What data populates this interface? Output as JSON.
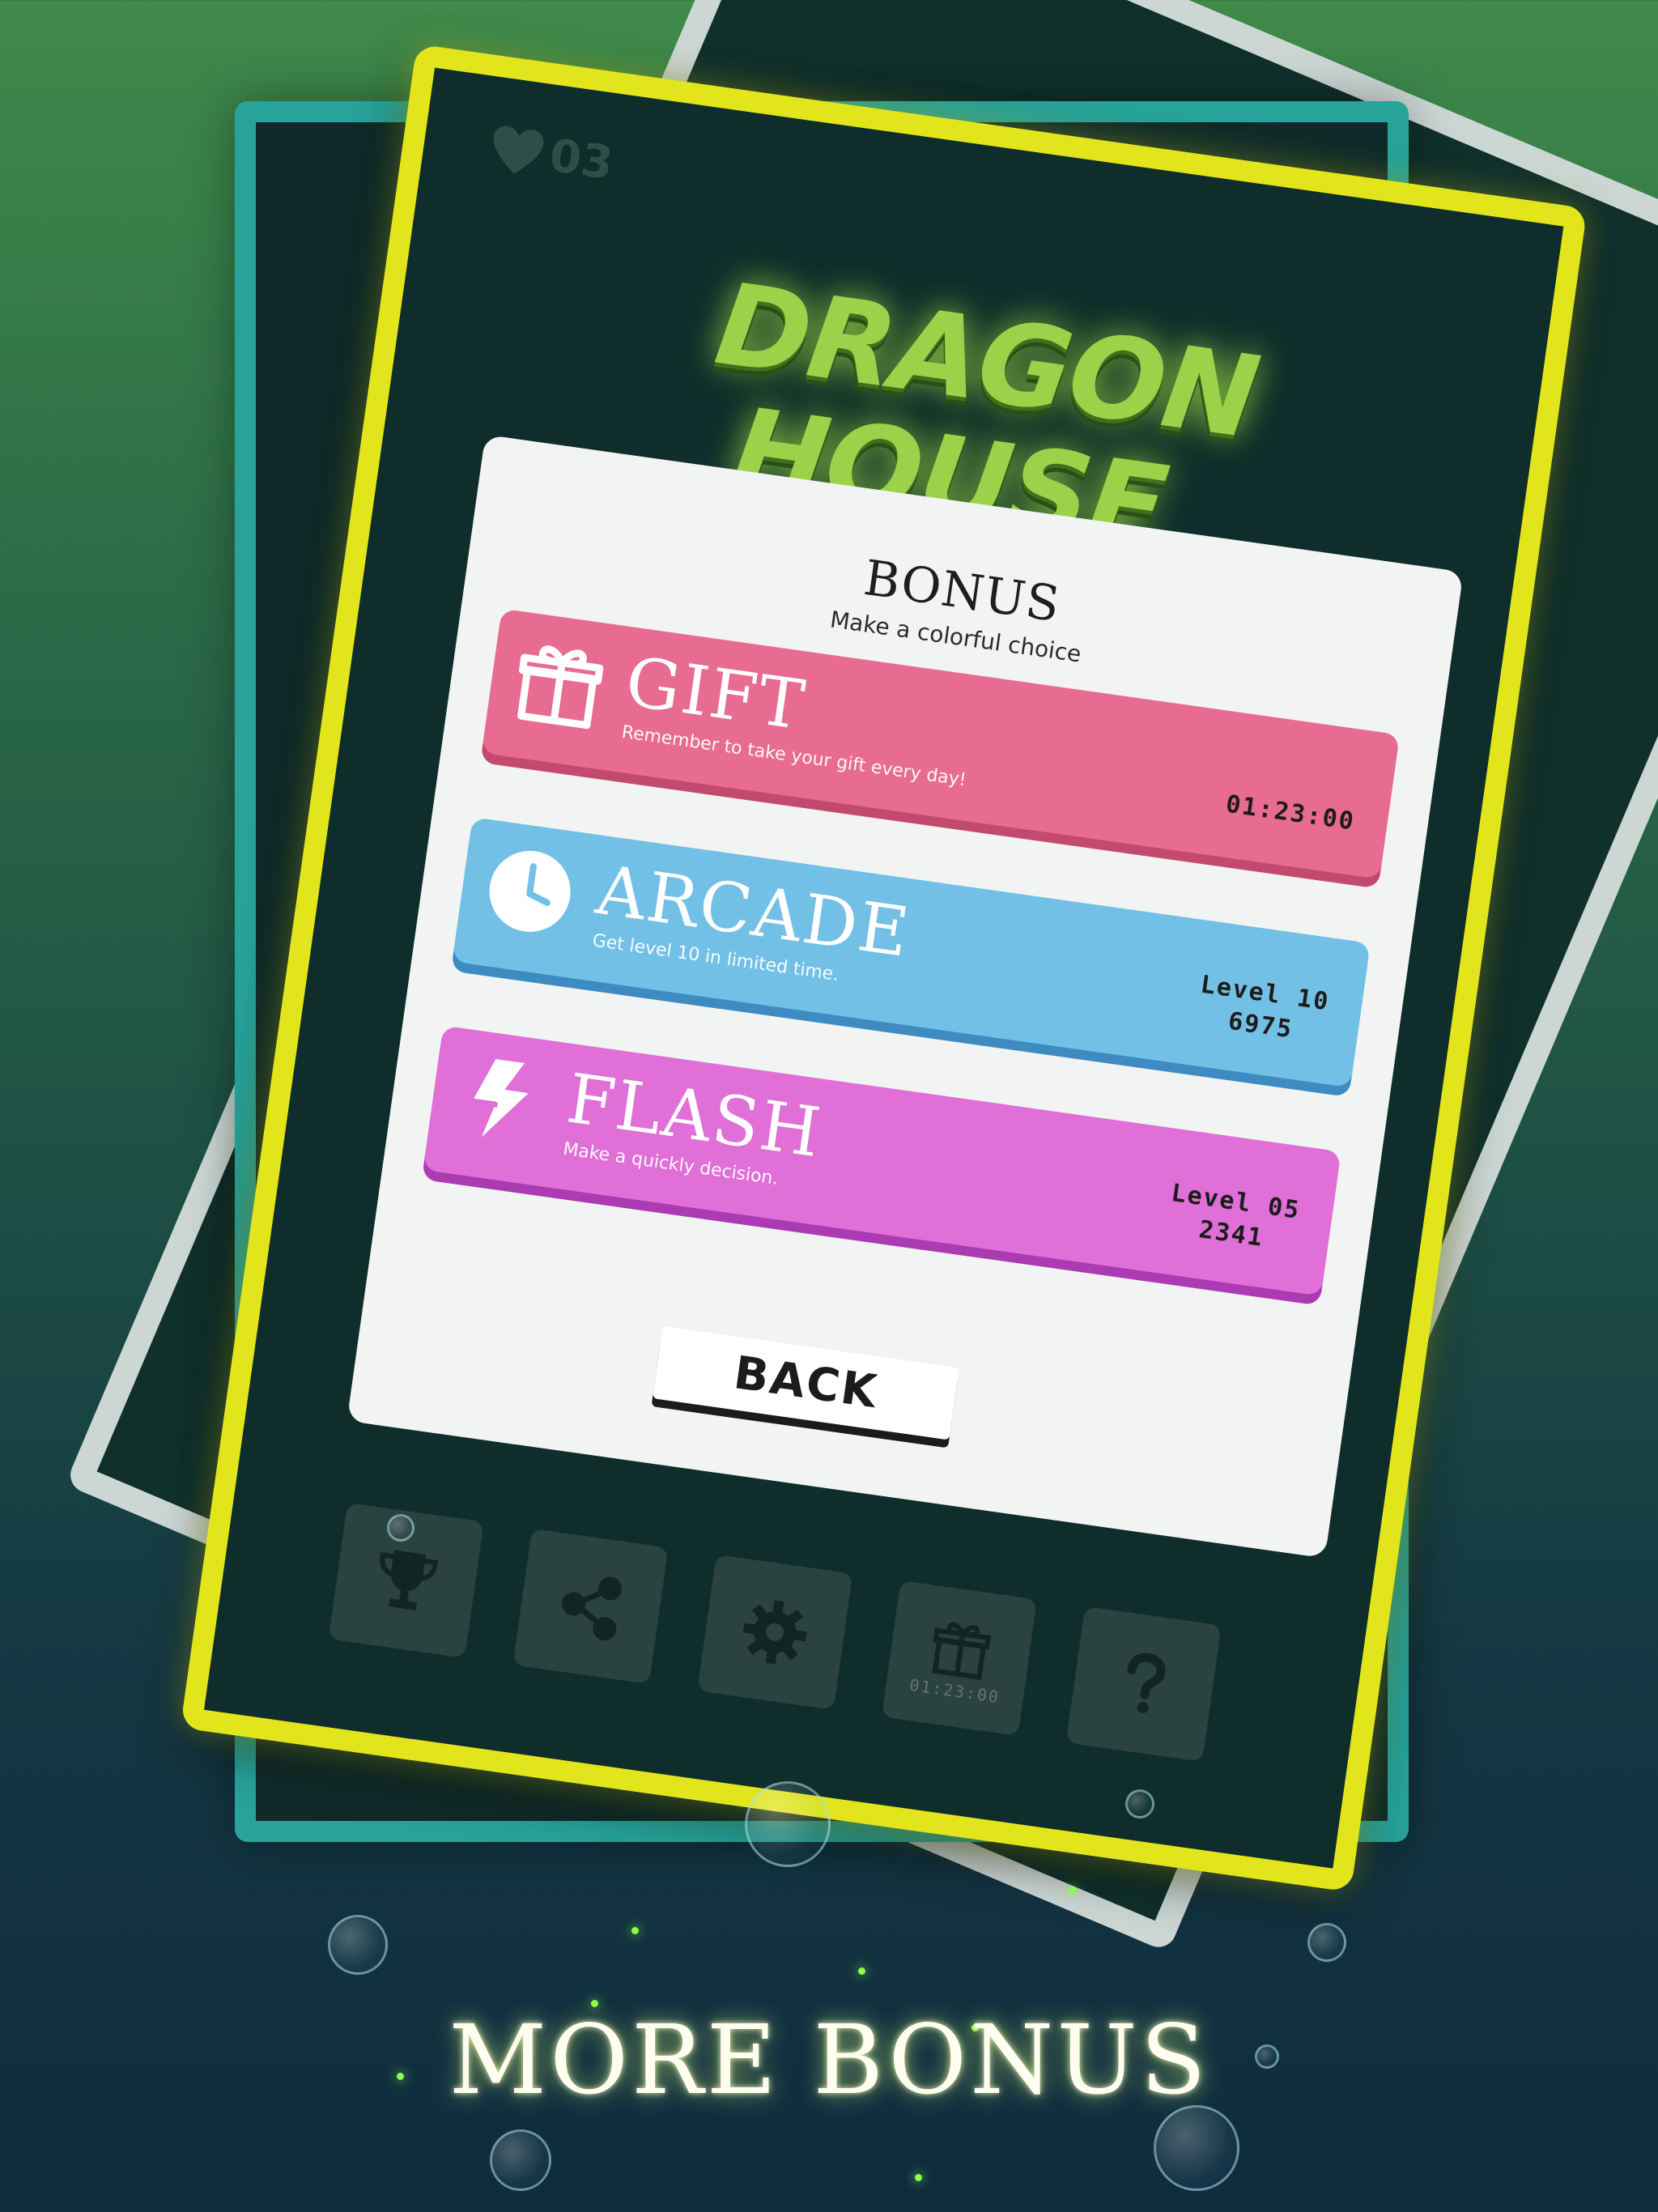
{
  "game": {
    "logo_line1": "DRAGON",
    "logo_line2": "HOUSE"
  },
  "hud": {
    "lives_count": "03",
    "lives_icon": "heart-icon"
  },
  "bonus_panel": {
    "title": "BONUS",
    "subtitle": "Make a colorful choice",
    "modes": [
      {
        "label": "GIFT",
        "description": "Remember to take your gift every day!",
        "stat_line1": "01:23:00",
        "stat_line2": "",
        "color": "#e86b91",
        "icon": "gift-icon"
      },
      {
        "label": "ARCADE",
        "description": "Get level 10 in limited time.",
        "stat_line1": "Level 10",
        "stat_line2": "6975",
        "color": "#73c0e6",
        "icon": "clock-icon"
      },
      {
        "label": "FLASH",
        "description": "Make a quickly decision.",
        "stat_line1": "Level 05",
        "stat_line2": "2341",
        "color": "#e06fd7",
        "icon": "lightning-icon"
      }
    ],
    "back_label": "BACK"
  },
  "bottom_nav": {
    "items": [
      {
        "icon": "trophy-icon"
      },
      {
        "icon": "share-icon"
      },
      {
        "icon": "gear-icon"
      },
      {
        "icon": "gift-icon",
        "timer": "01:23:00"
      },
      {
        "icon": "question-icon"
      }
    ]
  },
  "caption": "MORE BONUS",
  "colors": {
    "phone_frame": "#e3e51c",
    "teal_card": "#27a39a",
    "panel": "#f2f3f3"
  }
}
